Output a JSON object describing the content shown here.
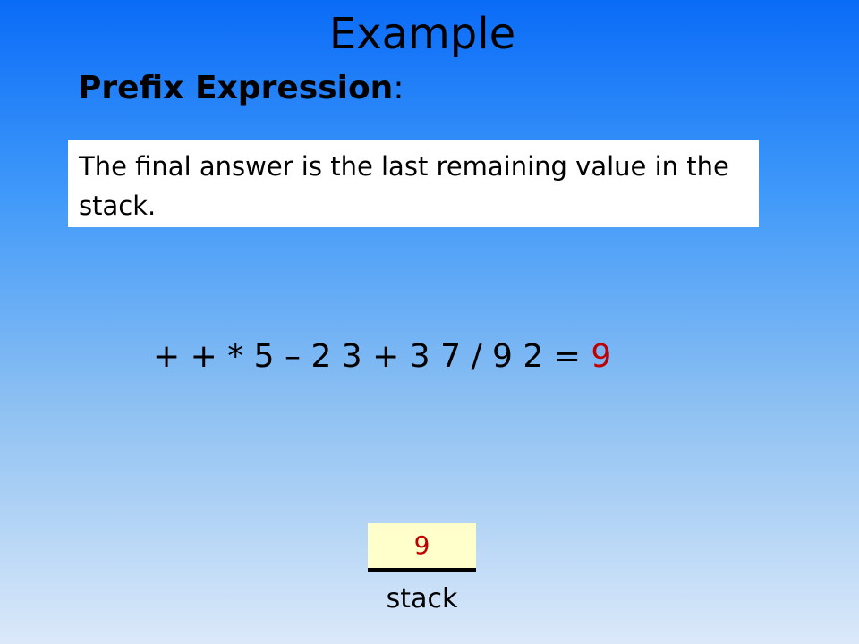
{
  "slide": {
    "title": "Example",
    "subtitle_bold": "Prefix Expression",
    "subtitle_rest": ":",
    "note": "The final answer is the last remaining value in the stack.",
    "expression": "+ + * 5 – 2 3 + 3 7 / 9 2 = ",
    "result": "9",
    "stack": {
      "value": "9",
      "label": "stack"
    }
  },
  "colors": {
    "result": "#c00000",
    "stack_fill": "#ffffcc",
    "background_top": "#0a6bf7",
    "background_bottom": "#dbe9f9"
  }
}
